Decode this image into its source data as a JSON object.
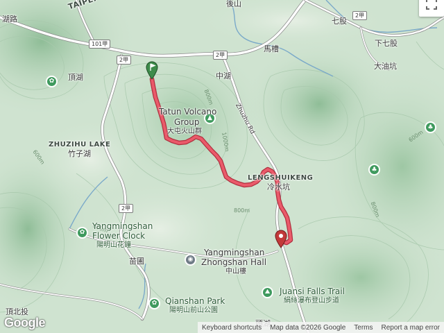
{
  "colors": {
    "route": "#ea5a6a",
    "route_outline": "#b0303f",
    "road": "#ffffff",
    "river": "#7aa9c9",
    "terrain_base": "#cfe3d0",
    "park_pin": "#3f9a5e",
    "landmark_pin": "#6f7b86"
  },
  "labels": {
    "taipei": "TAIPEI",
    "hu_road": "湖路",
    "houshan": "後山",
    "qigu": "七股",
    "xiaqigu": "下七股",
    "mazao": "馬槽",
    "dayoukeng": "大油坑",
    "dinghu": "頂湖",
    "zhonghu": "中湖",
    "zhuzihu_lake": "ZHUZIHU LAKE",
    "zhuzihu_zh": "竹子湖",
    "lengshuikeng": "LENGSHUIKENG",
    "lengshuikeng_zh": "冷水坑",
    "zhuzhu_rd": "Zhuzhu Rd",
    "miaopu": "苗圃",
    "dingbeitou": "頂北投",
    "toukeng": "頭湖"
  },
  "pois": {
    "tatun_name_1": "Tatun Volcano",
    "tatun_name_2": "Group",
    "tatun_zh": "大屯火山群",
    "flower_clock_1": "Yangmingshan",
    "flower_clock_2": "Flower Clock",
    "flower_clock_zh": "陽明山花鐘",
    "zhongshan_hall_1": "Yangmingshan",
    "zhongshan_hall_2": "Zhongshan Hall",
    "zhongshan_hall_zh": "中山樓",
    "qianshan_park": "Qianshan Park",
    "qianshan_park_zh": "陽明山前山公園",
    "juansi_falls": "Juansi Falls Trail",
    "juansi_falls_zh": "絹絲瀑布登山步道"
  },
  "road_shields": {
    "r101a": "101甲",
    "r2a_1": "2甲",
    "r2a_2": "2甲",
    "r2a_3": "2甲",
    "r2a_4": "2甲"
  },
  "contours": {
    "c600a": "600m",
    "c800a": "800m",
    "c1000": "1000m",
    "c800b": "800m",
    "c600b": "600m",
    "c800c": "800m",
    "c600c": "600m"
  },
  "icons": {
    "start": "start-flag-icon",
    "end": "end-pin-icon",
    "park": "park-icon",
    "mountain": "mountain-icon",
    "landmark": "landmark-icon",
    "hiking": "hiking-icon",
    "fullscreen": "fullscreen-icon"
  },
  "attribution": {
    "keyboard": "Keyboard shortcuts",
    "map_data": "Map data ©2026 Google",
    "terms": "Terms",
    "report": "Report a map error"
  },
  "logo": "Google"
}
